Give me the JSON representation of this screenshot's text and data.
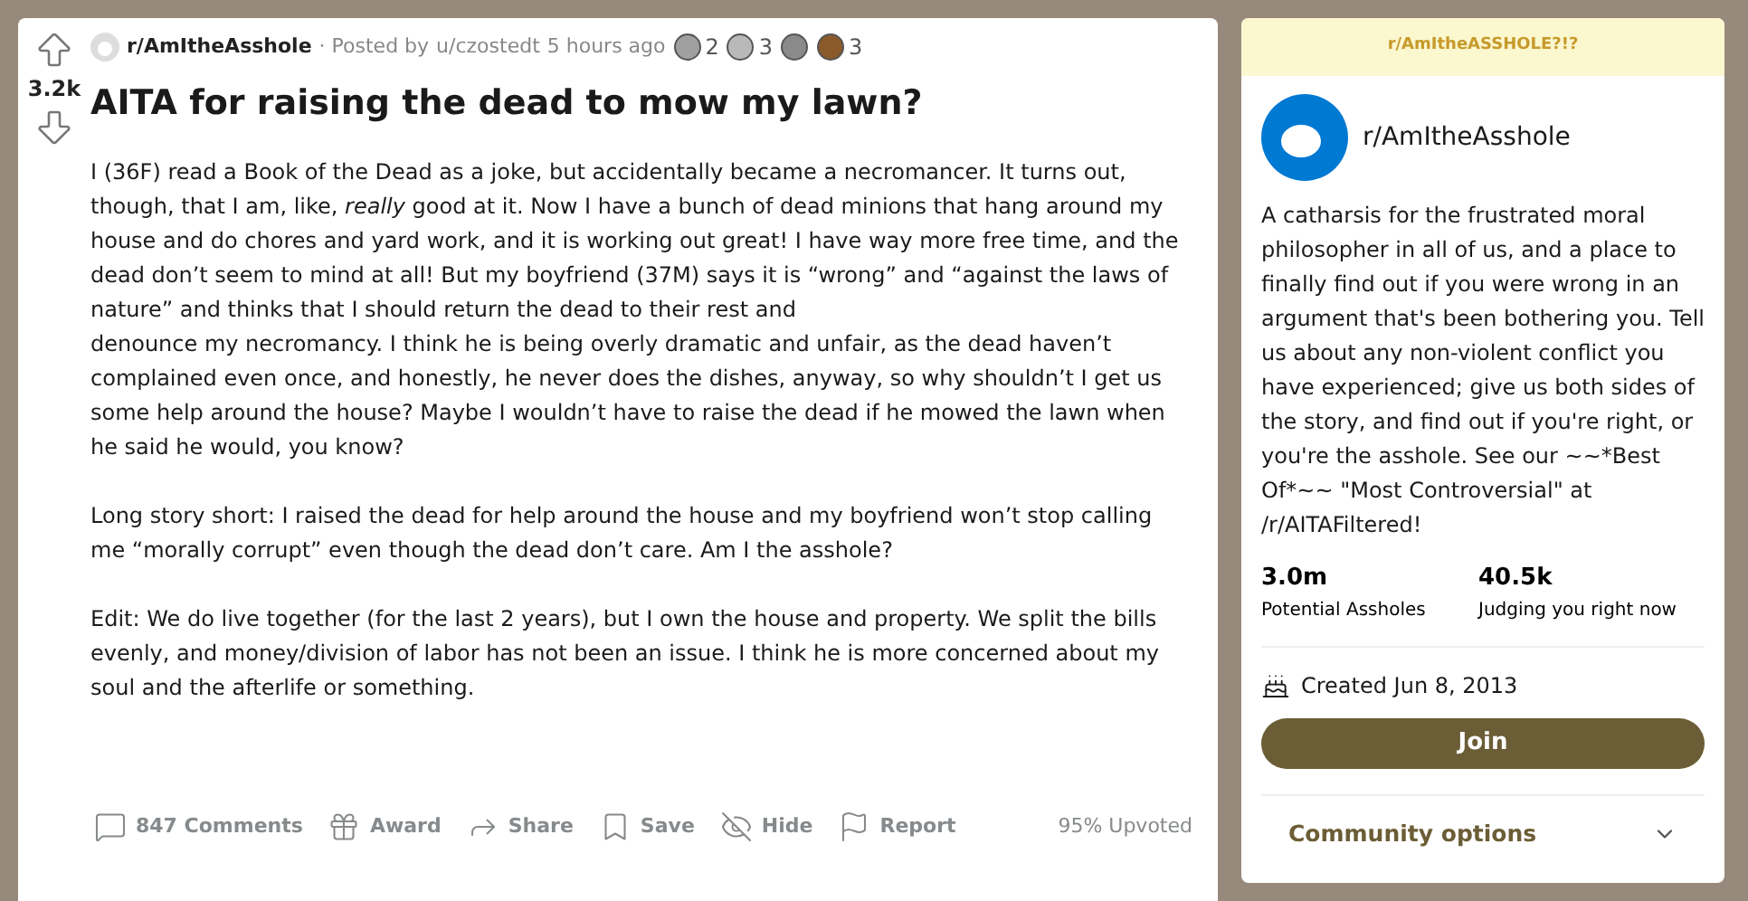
{
  "post": {
    "score": "3.2k",
    "subreddit": "r/AmItheAsshole",
    "posted_by": "· Posted by",
    "author": "u/czostedt",
    "time": "5 hours ago",
    "awards": [
      {
        "kind": "silver",
        "count": "2"
      },
      {
        "kind": "helpful",
        "count": "3"
      },
      {
        "kind": "coin"
      },
      {
        "kind": "bear",
        "count": "3"
      }
    ],
    "title": "AITA for raising the dead to mow my lawn?",
    "paragraphs": [
      "I (36F) read a Book of the Dead as a joke, but accidentally became a necromancer. It turns out, though, that I am, like, *really* good at it. Now I have a bunch of dead minions that hang around my house and do chores and yard work, and it  is working out great! I have way more free time, and the dead don’t seem to mind at all! But my boyfriend (37M) says it is “wrong” and “against the laws of nature” and thinks that I should return the dead to their rest and",
      "denounce my necromancy. I think he is being overly dramatic and unfair, as the dead haven’t complained even once, and honestly, he never does the dishes, anyway, so why shouldn’t I get us some help around the house? Maybe I wouldn’t have to raise the dead if he mowed the lawn when he said he would, you know?",
      "Long story short: I raised the dead for help around the house and my boyfriend won’t stop calling me “morally corrupt” even though the dead don’t care.  Am I the asshole?",
      "Edit: We do live together (for the last 2 years), but I own the house and property. We split the bills evenly, and money/division of labor has not been an issue. I think he is more concerned about my soul and the afterlife or something."
    ],
    "actions": [
      {
        "kind": "comments",
        "label": "847 Comments"
      },
      {
        "kind": "award",
        "label": "Award"
      },
      {
        "kind": "share",
        "label": "Share"
      },
      {
        "kind": "save",
        "label": "Save"
      },
      {
        "kind": "hide",
        "label": "Hide"
      },
      {
        "kind": "report",
        "label": "Report"
      }
    ],
    "upvoted": "95% Upvoted"
  },
  "sidebar": {
    "banner_text": "r/AmItheASSHOLE?!?",
    "name": "r/AmItheAsshole",
    "description": "A catharsis for the frustrated moral philosopher in all of us, and a place to finally find out if you were wrong in an argument that's been bothering you. Tell us about any non-violent conflict you have experienced; give us both sides of the story, and find out if you're right, or you're the asshole. See our ~~*Best Of*~~ \"Most Controversial\" at /r/AITAFiltered!",
    "stats": [
      {
        "value": "3.0m",
        "label": "Potential Assholes"
      },
      {
        "value": "40.5k",
        "label": "Judging you right now"
      }
    ],
    "created": "Created Jun 8, 2013",
    "join": "Join",
    "options": "Community options"
  }
}
